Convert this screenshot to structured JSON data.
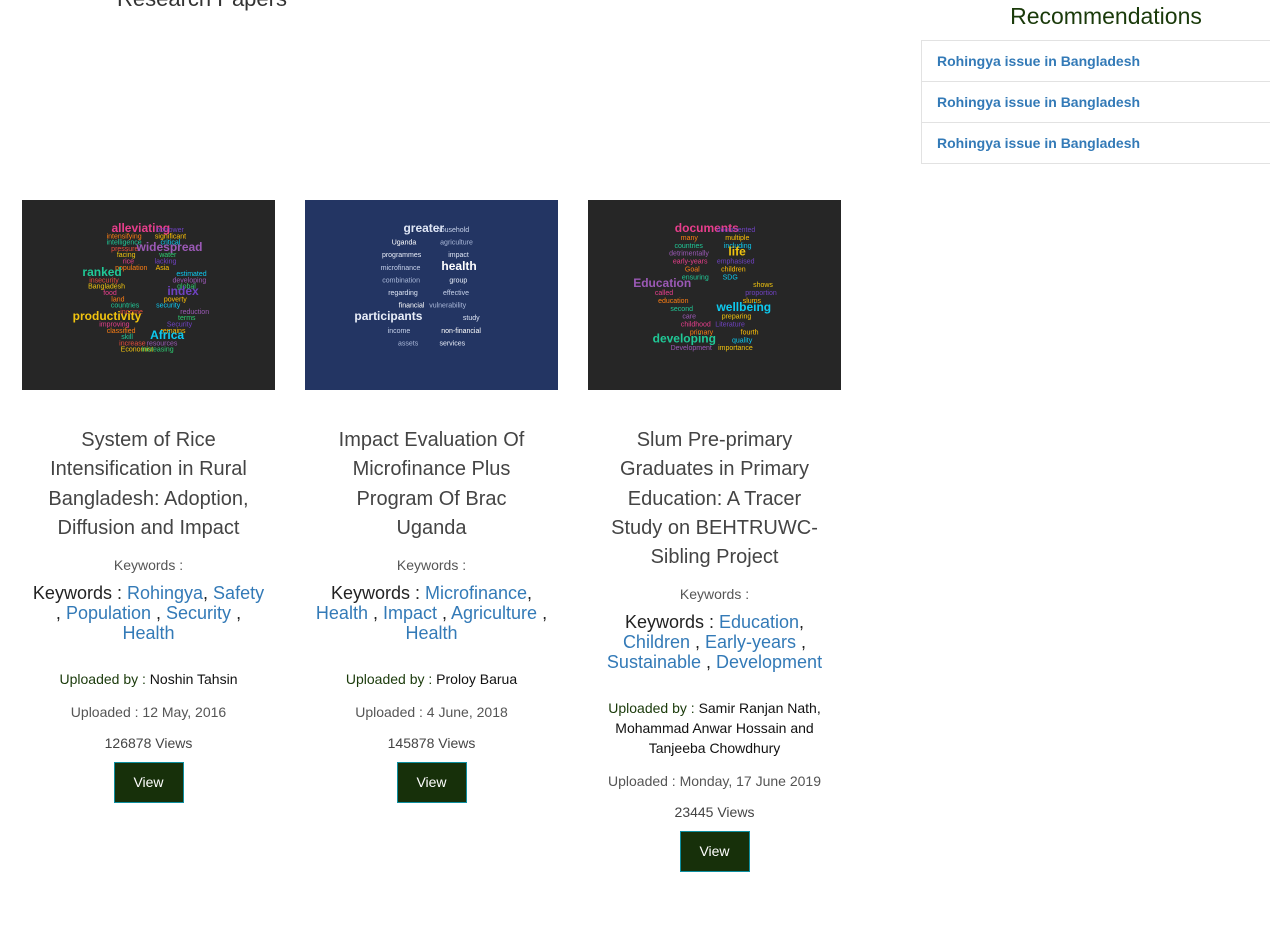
{
  "page": {
    "section_title": "Research Papers",
    "recommendations_title": "Recommendations"
  },
  "recommendations": [
    {
      "label": "Rohingya issue in Bangladesh"
    },
    {
      "label": "Rohingya issue in Bangladesh"
    },
    {
      "label": "Rohingya issue in Bangladesh"
    }
  ],
  "papers": [
    {
      "title": "System of Rice Intensification in Rural Bangladesh: Adoption, Diffusion and Impact",
      "keywords_caption": "Keywords :",
      "keywords_label": "Keywords : ",
      "keywords": [
        "Rohingya",
        "Safety",
        "Population",
        "Security",
        "Health"
      ],
      "uploaded_by_label": "Uploaded by : ",
      "uploaded_by": "Noshin Tahsin",
      "uploaded": "Uploaded : 12 May, 2016",
      "views": "126878 Views",
      "view_button": "View",
      "thumb_bg": "#262626",
      "thumb_words": [
        "alleviating",
        "borrower",
        "intensifying",
        "significant",
        "intelligence",
        "critical",
        "pressure",
        "widespread",
        "facing",
        "water",
        "rice",
        "lacking",
        "population",
        "Asia",
        "ranked",
        "estimated",
        "insecurity",
        "developing",
        "Bangladesh",
        "global",
        "food",
        "index",
        "land",
        "poverty",
        "countries",
        "security",
        "income",
        "reduction",
        "productivity",
        "terms",
        "improving",
        "Security",
        "classified",
        "remains",
        "skill",
        "Africa",
        "increase",
        "resources",
        "Economist",
        "increasing"
      ]
    },
    {
      "title": "Impact Evaluation Of Microfinance Plus Program Of Brac Uganda",
      "keywords_caption": "Keywords :",
      "keywords_label": "Keywords : ",
      "keywords": [
        "Microfinance",
        "Health",
        "Impact",
        "Agriculture",
        "Health"
      ],
      "uploaded_by_label": "Uploaded by : ",
      "uploaded_by": "Proloy Barua",
      "uploaded": "Uploaded : 4 June, 2018",
      "views": "145878 Views",
      "view_button": "View",
      "thumb_bg": "#233563",
      "thumb_words": [
        "greater",
        "household",
        "Uganda",
        "agriculture",
        "programmes",
        "impact",
        "microfinance",
        "health",
        "combination",
        "group",
        "regarding",
        "effective",
        "financial",
        "vulnerability",
        "participants",
        "study",
        "income",
        "non-financial",
        "assets",
        "services"
      ]
    },
    {
      "title": "Slum Pre-primary Graduates in Primary Education: A Tracer Study on BEHTRUWC-Sibling Project",
      "keywords_caption": "Keywords :",
      "keywords_label": "Keywords : ",
      "keywords": [
        "Education",
        "Children",
        "Early-years",
        "Sustainable",
        "Development"
      ],
      "uploaded_by_label": "Uploaded by : ",
      "uploaded_by": "Samir Ranjan Nath, Mohammad Anwar Hossain and Tanjeeba Chowdhury",
      "uploaded": "Uploaded : Monday, 17 June 2019",
      "views": "23445 Views",
      "view_button": "View",
      "thumb_bg": "#262626",
      "thumb_words": [
        "documents",
        "documented",
        "many",
        "multiple",
        "countries",
        "including",
        "detrimentally",
        "life",
        "early-years",
        "emphasised",
        "Goal",
        "children",
        "ensuring",
        "SDG",
        "Education",
        "shows",
        "called",
        "proportion",
        "education",
        "slums",
        "second",
        "wellbeing",
        "care",
        "preparing",
        "childhood",
        "Literature",
        "primary",
        "fourth",
        "developing",
        "quality",
        "Development",
        "importance"
      ]
    }
  ],
  "colors": {
    "link": "#337ab7",
    "button_bg": "#17300a",
    "button_border": "#0e8fa0",
    "heading_dark_green": "#1a3a0a"
  }
}
